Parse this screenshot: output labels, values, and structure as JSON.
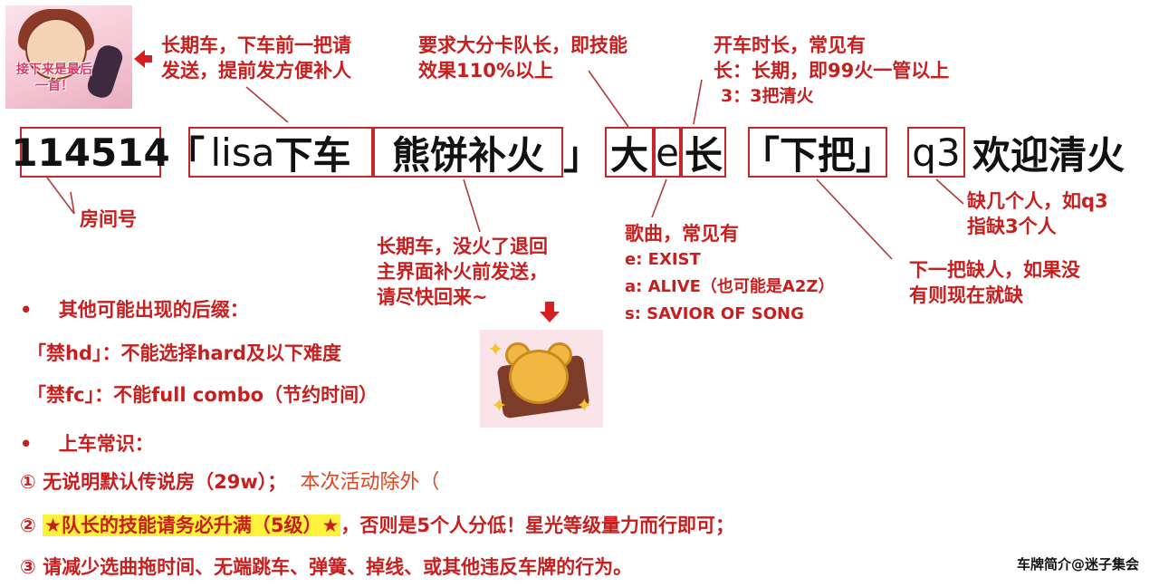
{
  "avatar": {
    "caption": "接下来是最后一首！"
  },
  "title_row": {
    "room_number": "114514",
    "open_bracket": "「",
    "name": "lisa",
    "leave": "下车",
    "cookie": "熊饼补火",
    "close_bracket": "」",
    "big": "大",
    "song": "e",
    "long": "长",
    "next_round": "「下把」",
    "q3": "q3",
    "welcome": "欢迎清火"
  },
  "annotations": {
    "avatar_note": [
      "长期车，下车前一把请",
      "发送，提前发方便补人"
    ],
    "leader_note": [
      "要求大分卡队长，即技能",
      "效果110%以上"
    ],
    "duration_note": [
      "开车时长，常见有",
      "长：长期，即99火一管以上",
      "3：3把清火"
    ],
    "room_note": "房间号",
    "cookie_note": [
      "长期车，没火了退回",
      "主界面补火前发送，",
      "请尽快回来~"
    ],
    "song_note_title": "歌曲，常见有",
    "song_note_items": [
      "e: EXIST",
      "a: ALIVE（也可能是A2Z）",
      "s: SAVIOR OF SONG"
    ],
    "q3_note": [
      "缺几个人，如q3",
      "指缺3个人"
    ],
    "next_note": [
      "下一把缺人，如果没",
      "有则现在就缺"
    ]
  },
  "suffixes": {
    "bullet": "•",
    "heading": "其他可能出现的后缀：",
    "items": [
      {
        "tag": "「禁hd」",
        "desc": "：不能选择hard及以下难度"
      },
      {
        "tag": "「禁fc」",
        "desc": "：不能full combo（节约时间）"
      }
    ]
  },
  "rules": {
    "bullet": "•",
    "heading": "上车常识：",
    "r1_num": "①",
    "r1_text": "无说明默认传说房（29w）；",
    "r1_extra": "本次活动除外（",
    "r2_num": "②",
    "r2_highlight": "★队长的技能请务必升满（5级）★",
    "r2_rest": "，否则是5个人分低！星光等级量力而行即可；",
    "r3_num": "③",
    "r3_text": "请减少选曲拖时间、无端跳车、弹簧、掉线、或其他违反车牌的行为。"
  },
  "footer": "车牌简介@迷子集会",
  "colors": {
    "accent_red": "#c81e1e",
    "box_red": "#c8262a",
    "highlight": "#fff23a",
    "orange": "#e0451f"
  }
}
